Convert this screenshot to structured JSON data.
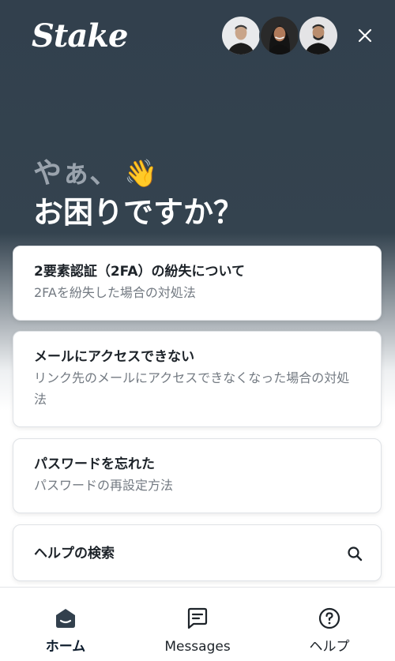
{
  "header": {
    "brand": "Stake",
    "avatars": [
      {
        "name": "support-agent-1"
      },
      {
        "name": "support-agent-2"
      },
      {
        "name": "support-agent-3"
      }
    ],
    "close_icon": "close-icon"
  },
  "greeting": {
    "line1": "やぁ、",
    "emoji": "👋",
    "line2": "お困りですか？"
  },
  "articles": [
    {
      "title": "2要素認証（2FA）の紛失について",
      "description": "2FAを紛失した場合の対処法"
    },
    {
      "title": "メールにアクセスできない",
      "description": "リンク先のメールにアクセスできなくなった場合の対処法"
    },
    {
      "title": "パスワードを忘れた",
      "description": "パスワードの再設定方法"
    }
  ],
  "search": {
    "label": "ヘルプの検索",
    "icon": "search-icon"
  },
  "nav": {
    "items": [
      {
        "label": "ホーム",
        "icon": "home-icon",
        "active": true
      },
      {
        "label": "Messages",
        "icon": "messages-icon",
        "active": false
      },
      {
        "label": "ヘルプ",
        "icon": "help-icon",
        "active": false
      }
    ]
  },
  "colors": {
    "header_bg": "#32404d",
    "text_dark": "#1d2329",
    "text_muted": "#737a82",
    "greeting_muted": "#9aa3ad"
  }
}
